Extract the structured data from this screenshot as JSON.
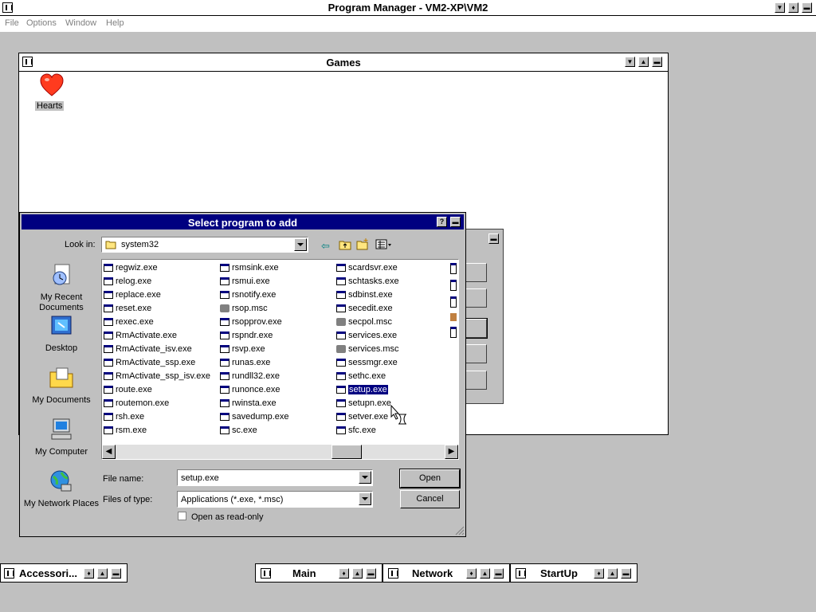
{
  "program_manager": {
    "title": "Program Manager - VM2-XP\\VM2",
    "menu": [
      "File",
      "Options",
      "Window",
      "Help"
    ]
  },
  "games_window": {
    "title": "Games",
    "icons": [
      {
        "label": "Hearts",
        "icon": "heart-icon"
      }
    ]
  },
  "dialog": {
    "title": "Select program to add",
    "look_in_label": "Look in:",
    "look_in_value": "system32",
    "places": [
      {
        "label": "My Recent Documents",
        "icon": "recent-documents-icon"
      },
      {
        "label": "Desktop",
        "icon": "desktop-icon"
      },
      {
        "label": "My Documents",
        "icon": "my-documents-icon"
      },
      {
        "label": "My Computer",
        "icon": "my-computer-icon"
      },
      {
        "label": "My Network Places",
        "icon": "network-places-icon"
      }
    ],
    "files": [
      [
        "regwiz.exe",
        "relog.exe",
        "replace.exe",
        "reset.exe",
        "rexec.exe",
        "RmActivate.exe",
        "RmActivate_isv.exe",
        "RmActivate_ssp.exe",
        "RmActivate_ssp_isv.exe",
        "route.exe",
        "routemon.exe",
        "rsh.exe",
        "rsm.exe"
      ],
      [
        "rsmsink.exe",
        "rsmui.exe",
        "rsnotify.exe",
        "rsop.msc",
        "rsopprov.exe",
        "rspndr.exe",
        "rsvp.exe",
        "runas.exe",
        "rundll32.exe",
        "runonce.exe",
        "rwinsta.exe",
        "savedump.exe",
        "sc.exe"
      ],
      [
        "scardsvr.exe",
        "schtasks.exe",
        "sdbinst.exe",
        "secedit.exe",
        "secpol.msc",
        "services.exe",
        "services.msc",
        "sessmgr.exe",
        "sethc.exe",
        "setup.exe",
        "setupn.exe",
        "setver.exe",
        "sfc.exe"
      ]
    ],
    "selected_file": "setup.exe",
    "file_name_label": "File name:",
    "file_name_value": "setup.exe",
    "file_type_label": "Files of type:",
    "file_type_value": "Applications (*.exe, *.msc)",
    "open_label": "Open",
    "cancel_label": "Cancel",
    "read_only_label": "Open as read-only",
    "read_only_checked": false,
    "help_button": "?"
  },
  "groups": [
    {
      "title": "Accessori..."
    },
    {
      "title": "Main"
    },
    {
      "title": "Network"
    },
    {
      "title": "StartUp"
    }
  ]
}
